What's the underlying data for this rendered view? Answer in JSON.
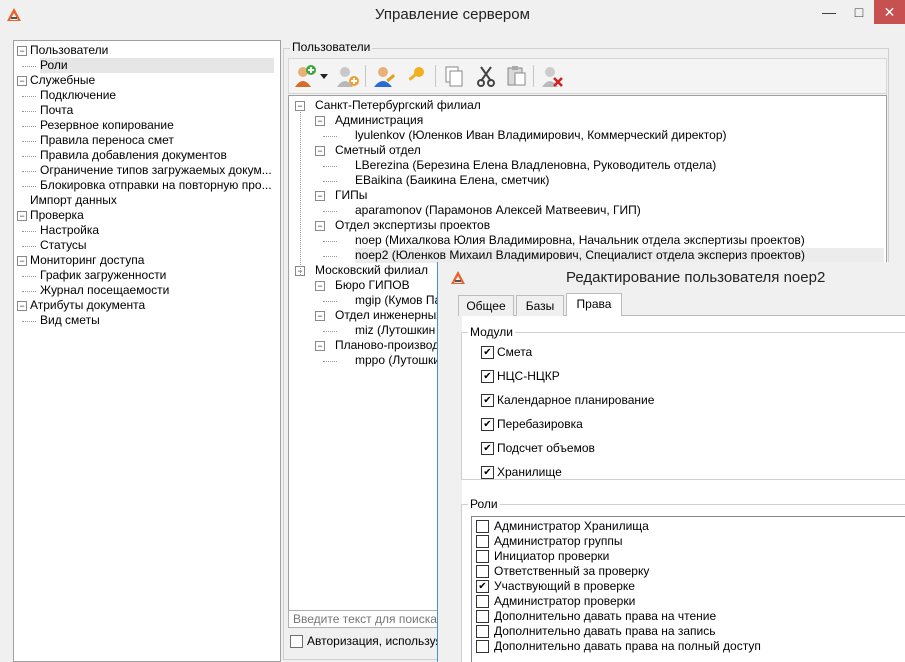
{
  "window": {
    "title": "Управление сервером",
    "minimize": "—",
    "maximize": "□",
    "close": "✕"
  },
  "nav": {
    "items": [
      {
        "label": "Пользователи",
        "level": 0,
        "expander": "−"
      },
      {
        "label": "Роли",
        "level": 1,
        "selected": true
      },
      {
        "label": "Служебные",
        "level": 0,
        "expander": "−"
      },
      {
        "label": "Подключение",
        "level": 1
      },
      {
        "label": "Почта",
        "level": 1
      },
      {
        "label": "Резервное копирование",
        "level": 1
      },
      {
        "label": "Правила переноса смет",
        "level": 1
      },
      {
        "label": "Правила добавления документов",
        "level": 1
      },
      {
        "label": "Ограничение типов загружаемых докум...",
        "level": 1
      },
      {
        "label": "Блокировка отправки на повторную про...",
        "level": 1
      },
      {
        "label": "Импорт данных",
        "level": 0
      },
      {
        "label": "Проверка",
        "level": 0,
        "expander": "−"
      },
      {
        "label": "Настройка",
        "level": 1
      },
      {
        "label": "Статусы",
        "level": 1
      },
      {
        "label": "Мониторинг доступа",
        "level": 0,
        "expander": "−"
      },
      {
        "label": "График загруженности",
        "level": 1
      },
      {
        "label": "Журнал посещаемости",
        "level": 1
      },
      {
        "label": "Атрибуты документа",
        "level": 0,
        "expander": "−"
      },
      {
        "label": "Вид сметы",
        "level": 1
      }
    ]
  },
  "users": {
    "group_label": "Пользователи",
    "toolbar": {
      "icons": [
        "add-user-icon",
        "dropdown-arrow-icon",
        "add-group-icon",
        "edit-user-icon",
        "key-icon",
        "copy-icon",
        "cut-icon",
        "paste-icon",
        "delete-user-icon"
      ]
    },
    "tree": [
      {
        "label": "Санкт-Петербургский филиал",
        "level": 0,
        "expander": "−"
      },
      {
        "label": "Администрация",
        "level": 1,
        "expander": "−"
      },
      {
        "label": "lyulenkov (Юленков Иван Владимирович, Коммерческий директор)",
        "level": 2
      },
      {
        "label": "Сметный отдел",
        "level": 1,
        "expander": "−"
      },
      {
        "label": "LBerezina (Березина Елена Владленовна, Руководитель отдела)",
        "level": 2
      },
      {
        "label": "EBaikina (Баикина Елена, сметчик)",
        "level": 2
      },
      {
        "label": "ГИПы",
        "level": 1,
        "expander": "−"
      },
      {
        "label": "aparamonov (Парамонов Алексей Матвеевич, ГИП)",
        "level": 2
      },
      {
        "label": "Отдел экспертизы проектов",
        "level": 1,
        "expander": "−"
      },
      {
        "label": "noep (Михалкова Юлия Владимировна, Начальник отдела экспертизы проектов)",
        "level": 2
      },
      {
        "label": "noep2 (Юленков Михаил Владимирович, Специалист отдела экспериз проектов)",
        "level": 2,
        "highlighted": true
      },
      {
        "label": "Московский филиал",
        "level": 0,
        "expander": "−"
      },
      {
        "label": "Бюро ГИПОВ",
        "level": 1,
        "expander": "−"
      },
      {
        "label": "mgip (Кумов Па",
        "level": 2
      },
      {
        "label": "Отдел инженерных",
        "level": 1,
        "expander": "−"
      },
      {
        "label": "miz (Лутошкин",
        "level": 2
      },
      {
        "label": "Планово-производ",
        "level": 1,
        "expander": "−"
      },
      {
        "label": "mppo (Лутошки",
        "level": 2
      }
    ],
    "search_placeholder": "Введите текст для поиска...",
    "auth_label": "Авторизация, используя у"
  },
  "dialog": {
    "title": "Редактирование пользователя noep2",
    "tabs": [
      {
        "label": "Общее",
        "active": false
      },
      {
        "label": "Базы",
        "active": false
      },
      {
        "label": "Права",
        "active": true
      }
    ],
    "modules_legend": "Модули",
    "modules": [
      {
        "label": "Смета",
        "checked": true
      },
      {
        "label": "НЦС-НЦКР",
        "checked": true
      },
      {
        "label": "Календарное планирование",
        "checked": true
      },
      {
        "label": "Перебазировка",
        "checked": true
      },
      {
        "label": "Подсчет объемов",
        "checked": true
      },
      {
        "label": "Хранилище",
        "checked": true
      }
    ],
    "roles_legend": "Роли",
    "roles": [
      {
        "label": "Администратор Хранилища",
        "checked": false
      },
      {
        "label": "Администратор группы",
        "checked": false
      },
      {
        "label": "Инициатор проверки",
        "checked": false
      },
      {
        "label": "Ответственный за проверку",
        "checked": false
      },
      {
        "label": "Участвующий в проверке",
        "checked": true
      },
      {
        "label": "Администратор проверки",
        "checked": false
      },
      {
        "label": "Дополнительно давать права на чтение",
        "checked": false
      },
      {
        "label": "Дополнительно давать права на запись",
        "checked": false
      },
      {
        "label": "Дополнительно давать права на полный доступ",
        "checked": false
      }
    ]
  },
  "colors": {
    "close_button": "#c75050",
    "logo_orange": "#e8622a",
    "selection": "#e6e6e6"
  }
}
